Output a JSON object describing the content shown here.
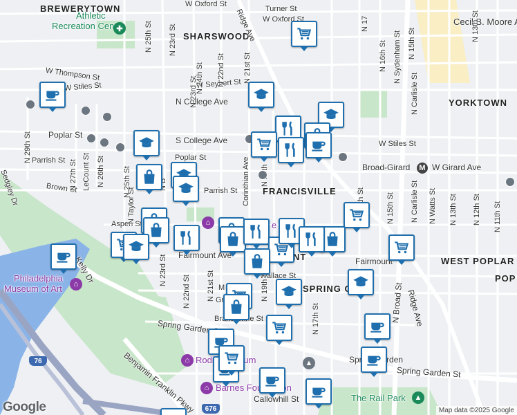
{
  "map": {
    "attribution": "Map data ©2025 Google",
    "logo": "Google",
    "colors": {
      "marker_border": "#1f6fae",
      "park": "#c8e6c9",
      "water": "#8ab4e8",
      "highway": "#9aa5c4"
    }
  },
  "neighborhoods": {
    "brewerytown": "BREWERYTOWN",
    "sharswood": "SHARSWOOD",
    "yorktown": "YORKTOWN",
    "francisville": "FRANCISVILLE",
    "west_poplar": "WEST POPLAR",
    "spring_garden_a": "SPRING GAR",
    "spring_garden_b": "N",
    "fairmount_ghost": "NT",
    "poplar_ghost": "POP"
  },
  "pois": {
    "athletic_1": "Athletic",
    "athletic_2": "Recreation Center",
    "museum_1": "Philadelphia",
    "museum_2": "Museum of Art",
    "rodin": "Rodin Museum",
    "barnes": "Barnes Foundation",
    "rail_park": "The Rail Park",
    "spring_garden_station": "Spring Garden",
    "broad_girard": "Broad-Girard",
    "fairmount_station": "Fairmount",
    "hidden_e": "e"
  },
  "streets": {
    "w_oxford": "W Oxford St",
    "turner": "Turner St",
    "w_oxford_2": "W Oxford St",
    "ridge_top": "Ridge Ave",
    "cecil": "Cecil B. Moore Av",
    "w_thompson": "W Thompson St",
    "w_stiles_left": "W Stiles St",
    "w_seybert": "W Seybert St",
    "n_college": "N College Ave",
    "poplar_left": "Poplar St",
    "s_college": "S College Ave",
    "poplar_mid": "Poplar St",
    "parrish_left": "Parrish St",
    "parrish_mid": "Parrish St",
    "brown": "Brown St",
    "aspen": "Aspen St",
    "fairmount_ave": "Fairmount Ave",
    "w_stiles_right": "W Stiles St",
    "w_girard": "W Girard Ave",
    "wallace": "Wallace St",
    "mt_vernon": "M",
    "green": "Gr",
    "brandywine": "Brandywine St",
    "spring_garden_st": "Spring Garden St",
    "spring_garden_st_r": "Spring Garden St",
    "callowhill": "Callowhill St",
    "kelly": "Kelly Dr",
    "bfp": "Benjamin Franklin Pkwy",
    "ridge_right": "Ridge Ave",
    "sedgley": "Sedgley Dr",
    "n_broad": "N Broad St",
    "n_25th": "N 25th St",
    "n_23rd_top": "N 23rd St",
    "n_22nd_top": "N 22nd St",
    "n_21st_top": "N 21st St",
    "n_24th": "N 24th St",
    "n_23rd": "N 23rd St",
    "n_29th": "N 29th St",
    "n_27th": "N 27th St",
    "lecount": "LeCount St",
    "n_26th": "N 26th St",
    "n_25th_b": "N 25th St",
    "n_taylor": "N Taylor St",
    "n_b": "N B",
    "corinthian": "Corinthian Ave",
    "n_20th": "N 20th",
    "n_22nd": "N 22nd St",
    "n_21st": "N 21st St",
    "n_19th": "N 19th St",
    "n_17th": "N 17th St",
    "n_16th_b": "16th St",
    "n_16th": "N 16th St",
    "n_sydenham": "N Sydenham St",
    "n_15th_top": "N 15th St",
    "n_carlisle_top": "N Carlisle St",
    "n_17_top": "N 17",
    "n_15th": "N 15th St",
    "n_carlisle": "N Carlisle St",
    "n_watts": "N Watts St",
    "n_13th": "N 13th St",
    "n_12th": "N 12th St",
    "n_11th": "N 11th St",
    "n_13th_top": "N 13th St",
    "n_23rd_low": "N 23rd St",
    "i76": "76",
    "i676": "676"
  },
  "markers": [
    {
      "kind": "cafe"
    },
    {
      "kind": "grocery"
    },
    {
      "kind": "school"
    },
    {
      "kind": "school"
    },
    {
      "kind": "restaurant"
    },
    {
      "kind": "shopping"
    },
    {
      "kind": "grocery"
    },
    {
      "kind": "restaurant"
    },
    {
      "kind": "cafe"
    },
    {
      "kind": "school"
    },
    {
      "kind": "shopping"
    },
    {
      "kind": "school"
    },
    {
      "kind": "school"
    },
    {
      "kind": "grocery"
    },
    {
      "kind": "shopping"
    },
    {
      "kind": "shopping"
    },
    {
      "kind": "grocery"
    },
    {
      "kind": "restaurant"
    },
    {
      "kind": "shopping"
    },
    {
      "kind": "shopping"
    },
    {
      "kind": "restaurant"
    },
    {
      "kind": "grocery"
    },
    {
      "kind": "restaurant"
    },
    {
      "kind": "shopping"
    },
    {
      "kind": "grocery"
    },
    {
      "kind": "school"
    },
    {
      "kind": "shopping"
    },
    {
      "kind": "school"
    },
    {
      "kind": "grocery"
    },
    {
      "kind": "grocery"
    },
    {
      "kind": "school"
    },
    {
      "kind": "school"
    },
    {
      "kind": "cafe"
    },
    {
      "kind": "grocery"
    },
    {
      "kind": "cafe"
    },
    {
      "kind": "cafe"
    },
    {
      "kind": "cafe"
    },
    {
      "kind": "cafe"
    },
    {
      "kind": "cafe"
    },
    {
      "kind": "cafe"
    },
    {
      "kind": "grocery"
    },
    {
      "kind": "cafe"
    },
    {
      "kind": "restaurant"
    }
  ]
}
